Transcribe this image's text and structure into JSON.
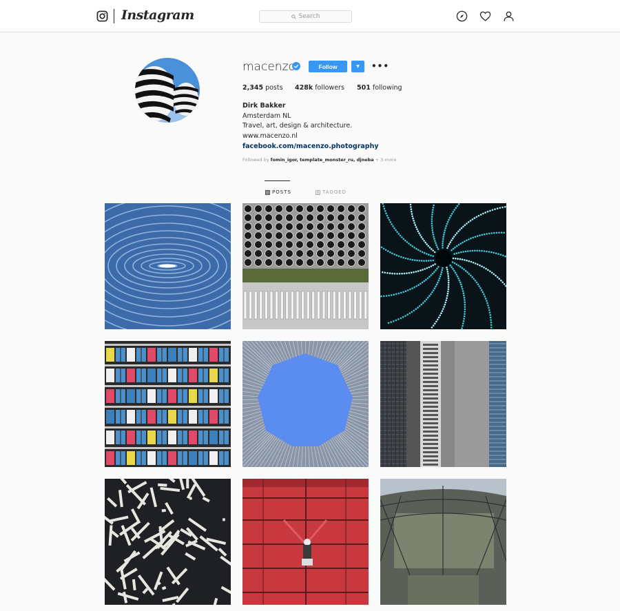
{
  "header": {
    "logo_text": "Instagram",
    "search_placeholder": "Search",
    "icons": [
      "instagram-camera-icon",
      "search-icon",
      "explore-compass-icon",
      "heart-icon",
      "profile-icon"
    ]
  },
  "profile": {
    "username": "macenzo",
    "verified": true,
    "follow_label": "Follow",
    "more_label": "•••",
    "stats": {
      "posts_count": "2,345",
      "posts_label": "posts",
      "followers_count": "428k",
      "followers_label": "followers",
      "following_count": "501",
      "following_label": "following"
    },
    "bio": {
      "name": "Dirk Bakker",
      "location": "Amsterdam NL",
      "description": "Travel, art, design & architecture.",
      "website": "www.macenzo.nl",
      "link": "facebook.com/macenzo.photography"
    },
    "followed_by": {
      "prefix": "Followed by",
      "names": "fomin_igor, template_monster_ru, djneba",
      "suffix": "+ 3 more"
    }
  },
  "tabs": {
    "posts": "POSTS",
    "tagged": "TAGGED"
  },
  "colors": {
    "accent": "#3897f0",
    "link": "#003569",
    "background": "#fafafa"
  }
}
